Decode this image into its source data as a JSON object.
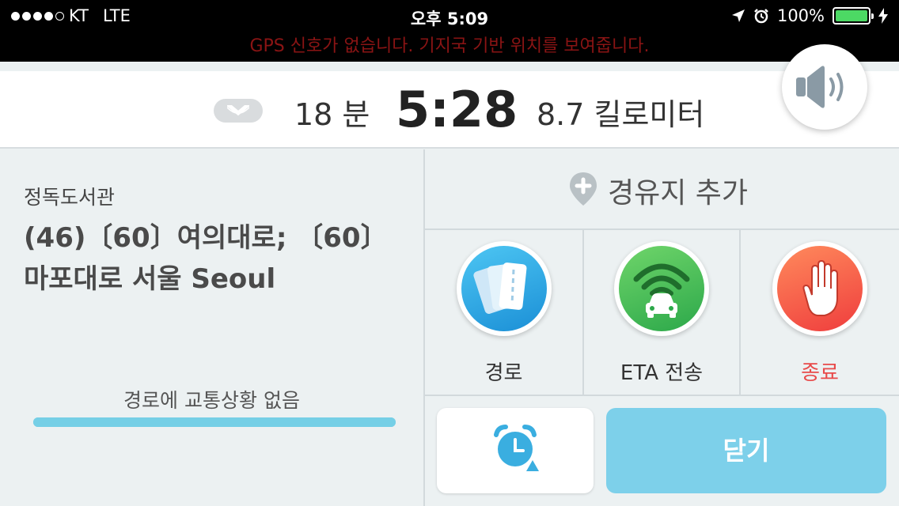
{
  "status_bar": {
    "carrier": "KT",
    "network": "LTE",
    "time": "오후 5:09",
    "battery": "100%",
    "signal_bars_filled": 4,
    "signal_bars_total": 5
  },
  "gps_banner": "GPS 신호가 없습니다. 기지국 기반 위치를 보여줍니다.",
  "trip": {
    "duration": "18 분",
    "eta": "5:28",
    "distance": "8.7 킬로미터"
  },
  "destination": {
    "name": "정독도서관",
    "address": "(46)〔60〕여의대로; 〔60〕마포대로 서울 Seoul"
  },
  "traffic": {
    "label": "경로에 교통상황 없음",
    "progress": 1.0
  },
  "add_stop": {
    "label": "경유지 추가",
    "icon": "pin-plus-icon"
  },
  "actions": [
    {
      "label": "경로",
      "icon": "route-cards-icon"
    },
    {
      "label": "ETA 전송",
      "icon": "car-wifi-icon"
    },
    {
      "label": "종료",
      "icon": "hand-stop-icon"
    }
  ],
  "buttons": {
    "alarm_icon": "alarm-clock-icon",
    "close": "닫기"
  },
  "colors": {
    "accent": "#7dd0ea",
    "stop_red": "#e84a4a",
    "gps_text": "#8a1414"
  }
}
